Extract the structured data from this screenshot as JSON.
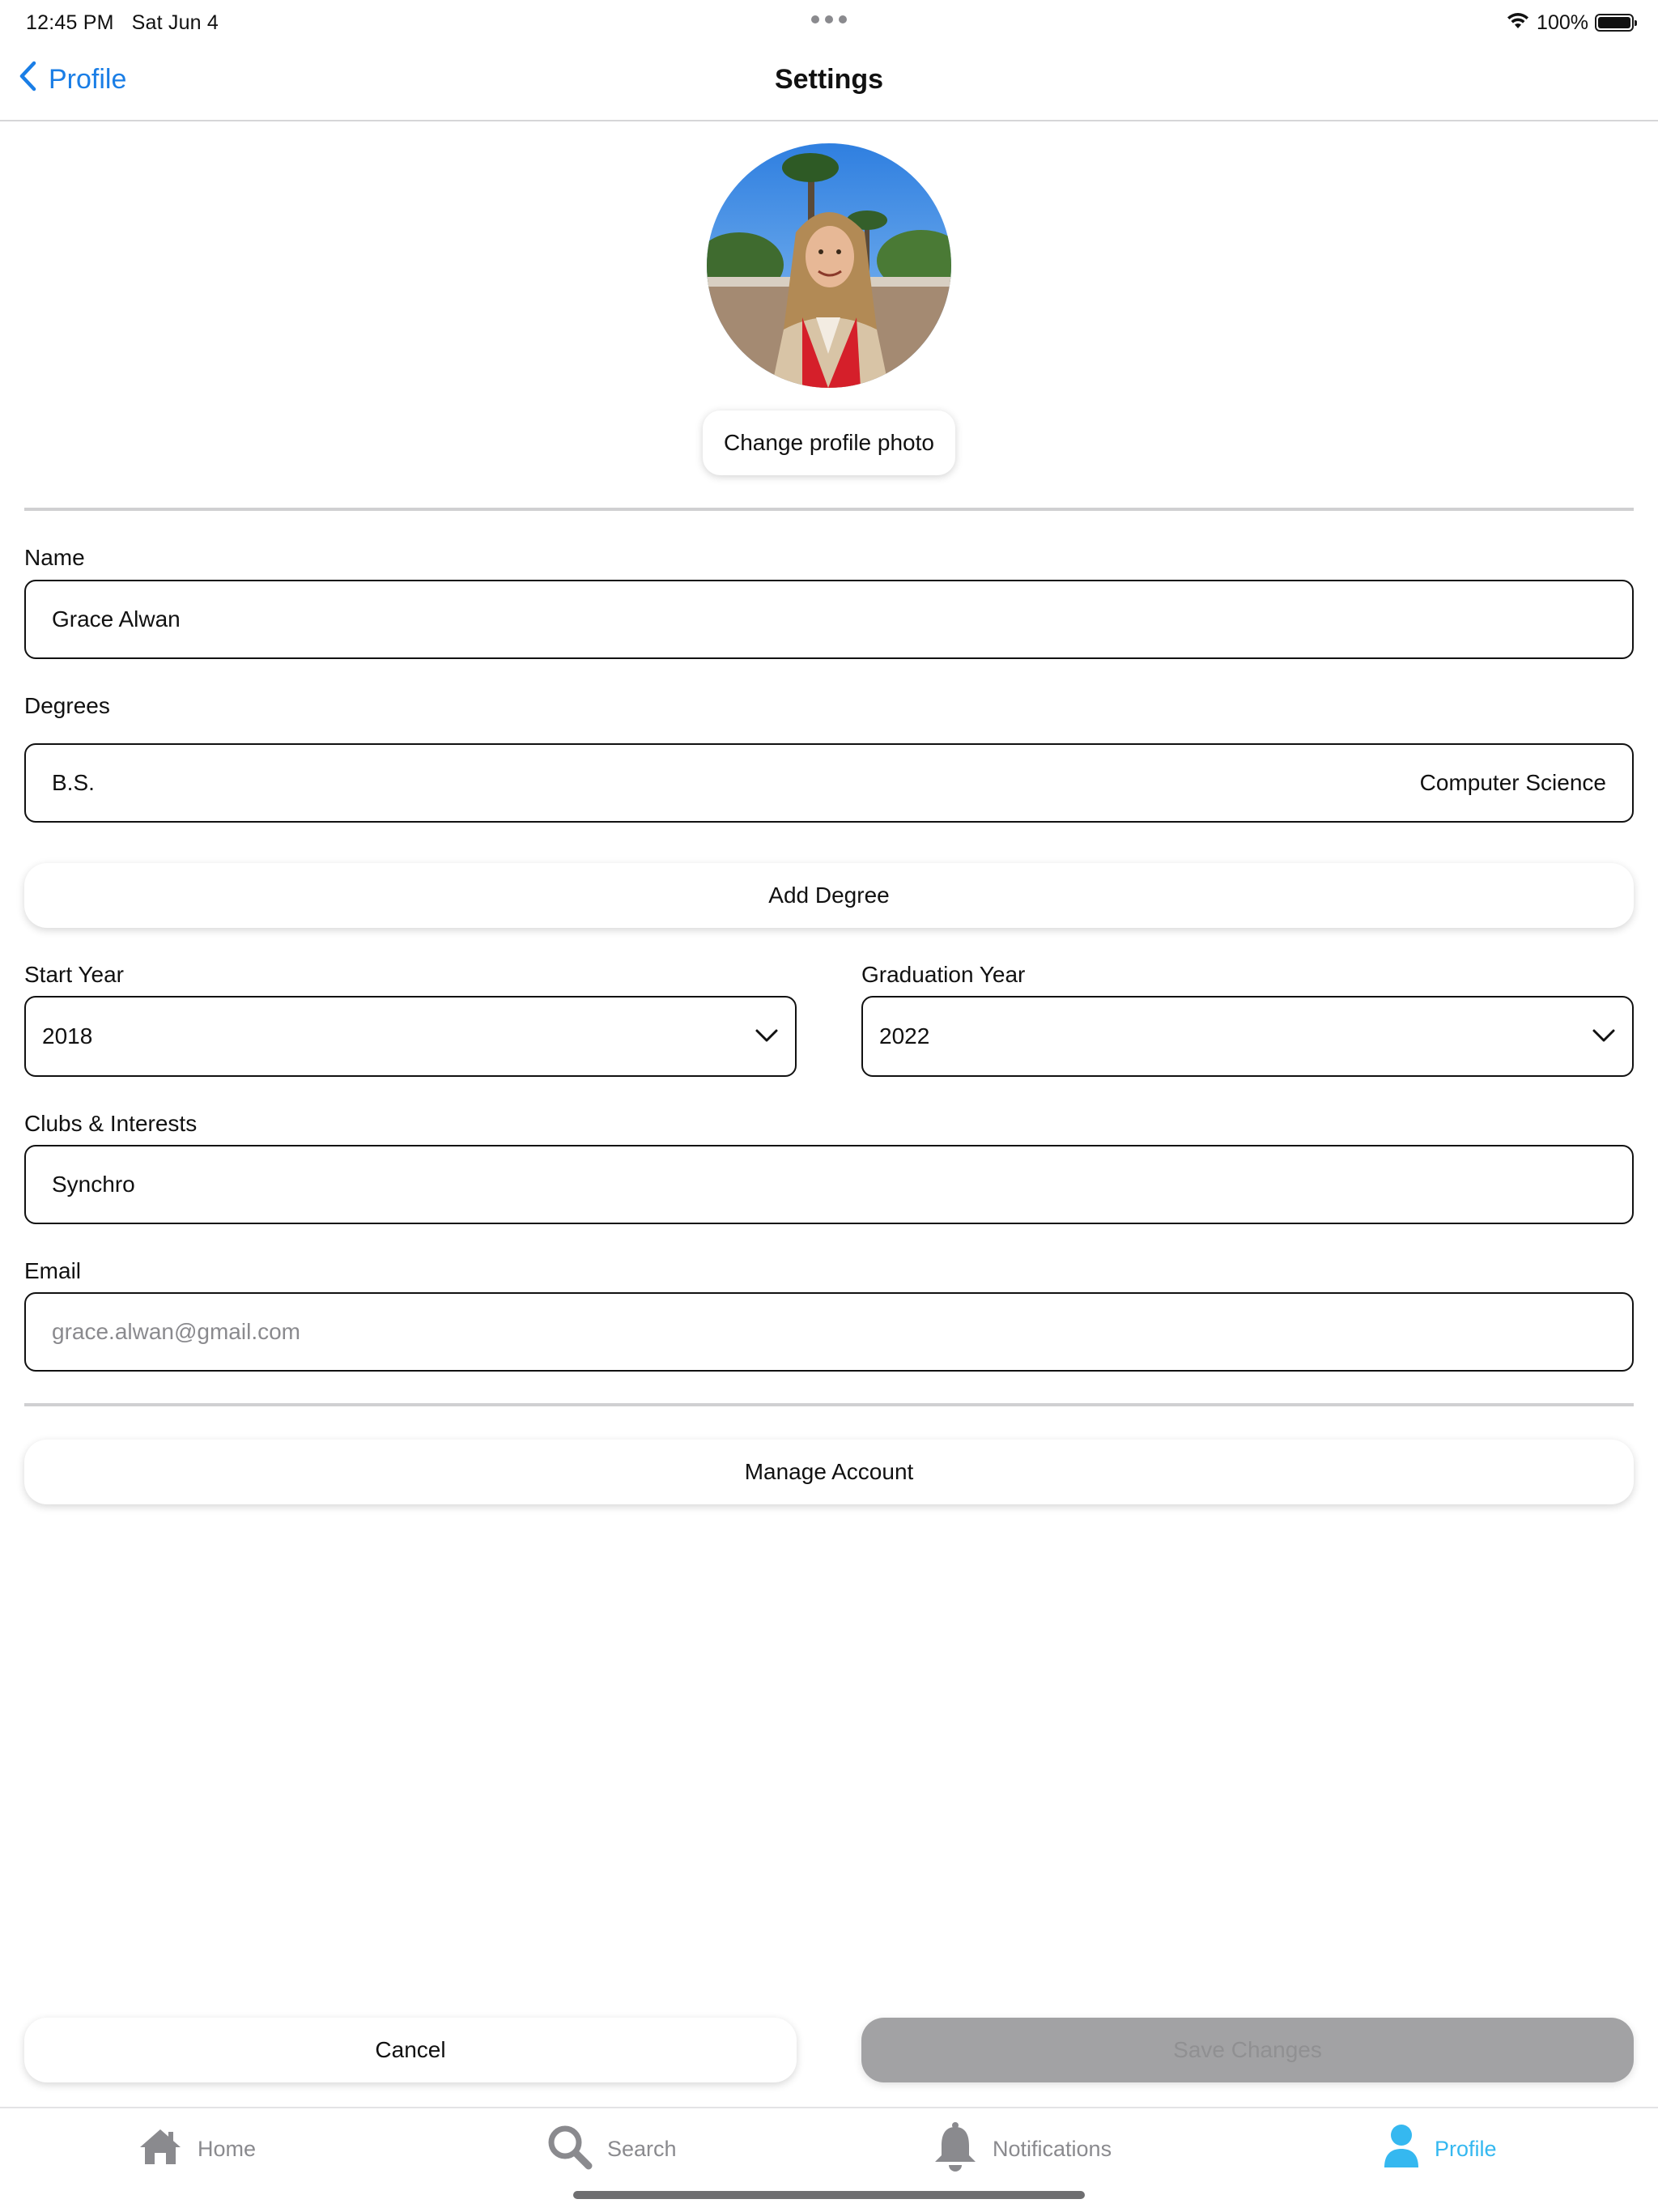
{
  "status_bar": {
    "time": "12:45 PM",
    "date": "Sat Jun 4",
    "battery": "100%",
    "icons": [
      "wifi-icon",
      "battery-icon",
      "more-dots-icon"
    ]
  },
  "nav": {
    "back_label": "Profile",
    "title": "Settings",
    "accent_color": "#1a7ee6"
  },
  "profile": {
    "change_photo_label": "Change profile photo"
  },
  "form": {
    "name_label": "Name",
    "name_value": "Grace Alwan",
    "degrees_label": "Degrees",
    "degree": {
      "type": "B.S.",
      "major": "Computer Science"
    },
    "add_degree_label": "Add Degree",
    "start_year_label": "Start Year",
    "start_year_value": "2018",
    "grad_year_label": "Graduation Year",
    "grad_year_value": "2022",
    "clubs_label": "Clubs & Interests",
    "clubs_value": "Synchro",
    "email_label": "Email",
    "email_placeholder": "grace.alwan@gmail.com",
    "manage_account_label": "Manage Account"
  },
  "actions": {
    "cancel_label": "Cancel",
    "save_label": "Save Changes"
  },
  "tabs": [
    {
      "label": "Home",
      "icon": "home-icon"
    },
    {
      "label": "Search",
      "icon": "search-icon"
    },
    {
      "label": "Notifications",
      "icon": "bell-icon"
    },
    {
      "label": "Profile",
      "icon": "person-icon"
    }
  ],
  "colors": {
    "tab_active": "#35b8f0",
    "tab_inactive": "#8a8a8e"
  }
}
